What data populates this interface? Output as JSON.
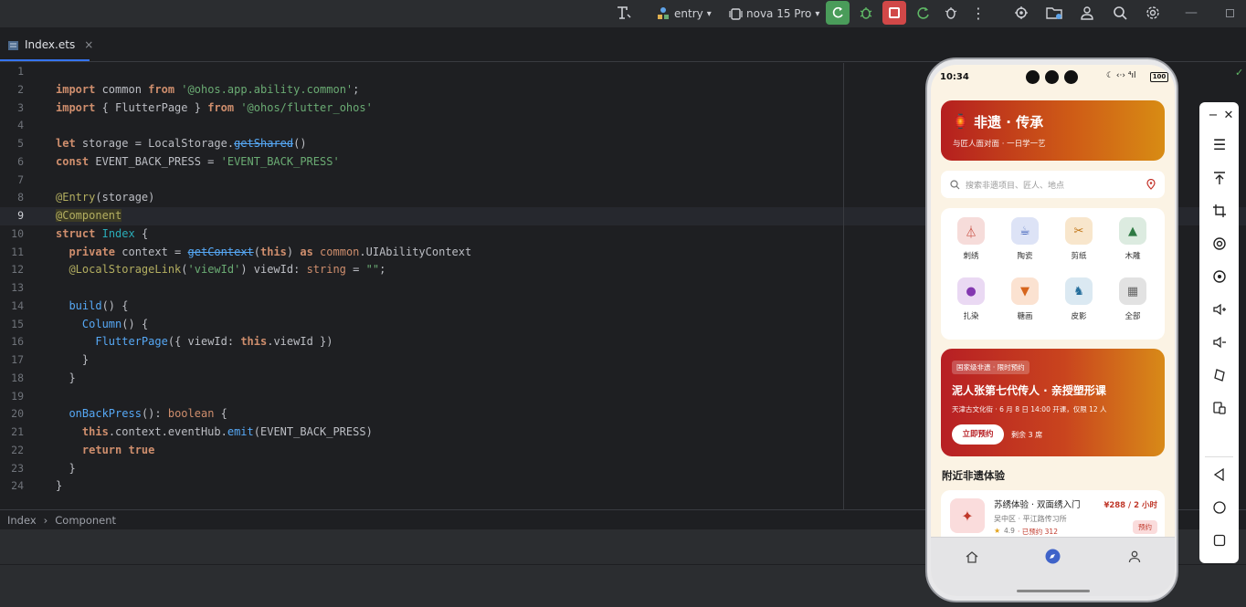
{
  "toolbar": {
    "module": "entry",
    "device": "nova 15 Pro"
  },
  "tab": {
    "filename": "Index.ets",
    "close": "×"
  },
  "editor": {
    "line_numbers": [
      "1",
      "2",
      "3",
      "4",
      "5",
      "6",
      "7",
      "8",
      "9",
      "10",
      "11",
      "12",
      "13",
      "14",
      "15",
      "16",
      "17",
      "18",
      "19",
      "20",
      "21",
      "22",
      "23",
      "24"
    ]
  },
  "breadcrumb": {
    "item1": "Index",
    "sep": "›",
    "item2": "Component"
  },
  "phone": {
    "status_time": "10:34",
    "status_battery": "100",
    "banner": {
      "title": "非遗 · 传承",
      "subtitle": "与匠人面对面 · 一日学一艺"
    },
    "search_placeholder": "搜索非遗项目、匠人、地点",
    "categories": [
      {
        "label": "刺绣",
        "icon": "hanger-icon"
      },
      {
        "label": "陶瓷",
        "icon": "teacup-icon"
      },
      {
        "label": "剪纸",
        "icon": "scissors-icon"
      },
      {
        "label": "木雕",
        "icon": "tree-icon"
      },
      {
        "label": "扎染",
        "icon": "palette-icon"
      },
      {
        "label": "糖画",
        "icon": "icecream-icon"
      },
      {
        "label": "皮影",
        "icon": "puppet-icon"
      },
      {
        "label": "全部",
        "icon": "grid-icon"
      }
    ],
    "promo": {
      "tag": "国家级非遗 · 限时预约",
      "title": "泥人张第七代传人 · 亲授塑形课",
      "detail": "天津古文化街 · 6 月 8 日 14:00 开课，仅限 12 人",
      "button": "立即预约",
      "remaining": "剩余 3 席"
    },
    "nearby_title": "附近非遗体验",
    "card": {
      "title": "苏绣体验 · 双面绣入门",
      "price": "¥288 / 2 小时",
      "location": "吴中区 · 平江路传习所",
      "rating": "4.9",
      "booked": "· 已预约 312",
      "button": "预约"
    }
  },
  "colors": {
    "keyword": "#cf8e6d",
    "string": "#6aab73",
    "decorator": "#b3ae60",
    "function": "#56a8f5",
    "run_green": "#4a9c5a",
    "stop_red": "#d14848",
    "brand_red": "#b51f1f"
  }
}
